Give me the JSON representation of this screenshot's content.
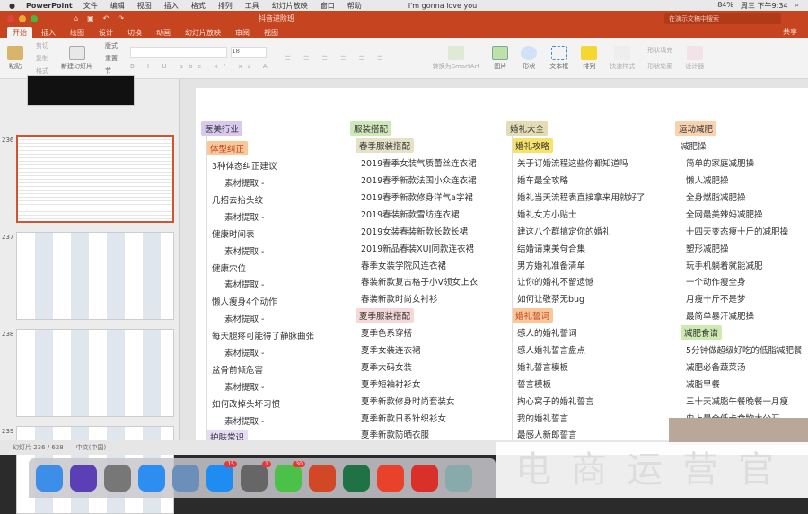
{
  "menubar": {
    "app": "PowerPoint",
    "items": [
      "文件",
      "编辑",
      "视图",
      "插入",
      "格式",
      "排列",
      "工具",
      "幻灯片放映",
      "窗口",
      "帮助"
    ],
    "song": "I'm gonna love you",
    "battery": "84%",
    "clock": "周三 下午9:34"
  },
  "titlebar": {
    "doc_title": "抖音进阶班",
    "search_placeholder": "在演示文稿中搜索",
    "share": "共享"
  },
  "tabs": [
    "开始",
    "插入",
    "绘图",
    "设计",
    "切换",
    "动画",
    "幻灯片放映",
    "审阅",
    "视图"
  ],
  "ribbon": {
    "paste": "粘贴",
    "cut": "剪切",
    "copy": "复制",
    "format": "格式",
    "new_slide": "新建幻灯片",
    "layout": "版式",
    "reset": "重置",
    "section": "节",
    "font_size": "18",
    "smartart": "转换为SmartArt",
    "picture": "图片",
    "shape": "形状",
    "textbox": "文本框",
    "arrange": "排列",
    "quick_styles": "快速样式",
    "shape_fill": "形状填充",
    "shape_outline": "形状轮廓",
    "design_ideas": "设计器"
  },
  "thumbnails": [
    {
      "num": "236",
      "selected": true
    },
    {
      "num": "237"
    },
    {
      "num": "238"
    },
    {
      "num": "239"
    }
  ],
  "mindmap": [
    {
      "root": "医美行业",
      "root_color": "#d9c9ef",
      "nodes": [
        {
          "t": "体型纠正",
          "sub": "#f9c79a"
        },
        {
          "t": "3种体态纠正建议",
          "l": 1
        },
        {
          "t": "素材提取 -",
          "l": 2
        },
        {
          "t": "几招去抬头纹",
          "l": 1
        },
        {
          "t": "素材提取 -",
          "l": 2
        },
        {
          "t": "健康时间表",
          "l": 1
        },
        {
          "t": "素材提取 -",
          "l": 2
        },
        {
          "t": "健康穴位",
          "l": 1
        },
        {
          "t": "素材提取 -",
          "l": 2
        },
        {
          "t": "懒人瘦身4个动作",
          "l": 1
        },
        {
          "t": "素材提取 -",
          "l": 2
        },
        {
          "t": "每天腿疼可能得了静脉曲张",
          "l": 1
        },
        {
          "t": "素材提取 -",
          "l": 2
        },
        {
          "t": "盆骨前倾危害",
          "l": 1
        },
        {
          "t": "素材提取 -",
          "l": 2
        },
        {
          "t": "如何改掉头坏习惯",
          "l": 1
        },
        {
          "t": "素材提取 -",
          "l": 2
        },
        {
          "t": "护肤常识",
          "sub": "#e6dcf5"
        }
      ]
    },
    {
      "root": "服装搭配",
      "root_color": "#cfe8b8",
      "nodes": [
        {
          "t": "春季服装搭配",
          "sub": "#e6e2c8"
        },
        {
          "t": "2019春季女装气质蕾丝连衣裙",
          "l": 1
        },
        {
          "t": "2019春季新款法国小众连衣裙",
          "l": 1
        },
        {
          "t": "2019春季新款修身洋气a字裙",
          "l": 1
        },
        {
          "t": "2019春装新款雪纺连衣裙",
          "l": 1
        },
        {
          "t": "2019女装春装新款长款长裙",
          "l": 1
        },
        {
          "t": "2019新品春装XUJ同款连衣裙",
          "l": 1
        },
        {
          "t": "春季女装学院风连衣裙",
          "l": 1
        },
        {
          "t": "春装新款复古格子小V领女上衣",
          "l": 1
        },
        {
          "t": "春装新款时尚女衬衫",
          "l": 1
        },
        {
          "t": "夏季服装搭配",
          "sub": "#f5d9d9"
        },
        {
          "t": "夏季色系穿搭",
          "l": 1
        },
        {
          "t": "夏季女装连衣裙",
          "l": 1
        },
        {
          "t": "夏季大码女装",
          "l": 1
        },
        {
          "t": "夏季短袖衬衫女",
          "l": 1
        },
        {
          "t": "夏季新款修身时尚套装女",
          "l": 1
        },
        {
          "t": "夏季新款日系针织衫女",
          "l": 1
        },
        {
          "t": "夏季新款防晒衣服",
          "l": 1
        }
      ]
    },
    {
      "root": "婚礼大全",
      "root_color": "#e3dcb5",
      "nodes": [
        {
          "t": "婚礼攻略",
          "sub": "#f7e36a"
        },
        {
          "t": "关于订婚流程这些你都知道吗",
          "l": 1
        },
        {
          "t": "婚车最全攻略",
          "l": 1
        },
        {
          "t": "婚礼当天流程表直接拿来用就好了",
          "l": 1
        },
        {
          "t": "婚礼女方小贴士",
          "l": 1
        },
        {
          "t": "建这八个群搞定你的婚礼",
          "l": 1
        },
        {
          "t": "结婚请柬美句合集",
          "l": 1
        },
        {
          "t": "男方婚礼准备清单",
          "l": 1
        },
        {
          "t": "让你的婚礼不留遗憾",
          "l": 1
        },
        {
          "t": "如何让敬茶无bug",
          "l": 1
        },
        {
          "t": "婚礼誓词",
          "sub": "#f9c79a"
        },
        {
          "t": "感人的婚礼誓词",
          "l": 1
        },
        {
          "t": "感人婚礼誓言盘点",
          "l": 1
        },
        {
          "t": "婚礼誓言模板",
          "l": 1
        },
        {
          "t": "誓言模板",
          "l": 1
        },
        {
          "t": "掏心窝子的婚礼誓言",
          "l": 1
        },
        {
          "t": "我的婚礼誓言",
          "l": 1
        },
        {
          "t": "最感人新郎誓言",
          "l": 1
        }
      ]
    },
    {
      "root": "运动减肥",
      "root_color": "#f9d2b0",
      "nodes": [
        {
          "t": "减肥操",
          "l": 0
        },
        {
          "t": "简单的家庭减肥操",
          "l": 1
        },
        {
          "t": "懒人减肥操",
          "l": 1
        },
        {
          "t": "全身燃脂减肥操",
          "l": 1
        },
        {
          "t": "全网最美辣妈减肥操",
          "l": 1
        },
        {
          "t": "十四天变态瘦十斤的减肥操",
          "l": 1
        },
        {
          "t": "塑形减肥操",
          "l": 1
        },
        {
          "t": "玩手机躺着就能减肥",
          "l": 1
        },
        {
          "t": "一个动作瘦全身",
          "l": 1
        },
        {
          "t": "月瘦十斤不是梦",
          "l": 1
        },
        {
          "t": "最简单暴汗减肥操",
          "l": 1
        },
        {
          "t": "减肥食谱",
          "sub": "#cdeab0"
        },
        {
          "t": "5分钟做超级好吃的低脂减肥餐",
          "l": 1
        },
        {
          "t": "减肥必备蔬菜汤",
          "l": 1
        },
        {
          "t": "减脂早餐",
          "l": 1
        },
        {
          "t": "三十天减脂午餐晚餐一月瘦",
          "l": 1
        },
        {
          "t": "史上最全低卡食物大公开",
          "l": 1
        }
      ]
    }
  ],
  "statusbar": {
    "slide": "幻灯片 236 / 628",
    "lang": "中文(中国)"
  },
  "dock": [
    {
      "name": "finder",
      "color": "#3d8ee8"
    },
    {
      "name": "siri",
      "color": "#5a3fb5"
    },
    {
      "name": "launchpad",
      "color": "#777"
    },
    {
      "name": "safari",
      "color": "#2e8df0"
    },
    {
      "name": "preview",
      "color": "#6b8fb8"
    },
    {
      "name": "app-store",
      "color": "#1e8cf0",
      "badge": "15"
    },
    {
      "name": "system-preferences",
      "color": "#666",
      "badge": "1"
    },
    {
      "name": "wechat",
      "color": "#4cc14a",
      "badge": "30"
    },
    {
      "name": "powerpoint",
      "color": "#d24726"
    },
    {
      "name": "excel",
      "color": "#1f7244"
    },
    {
      "name": "xmind",
      "color": "#e8412c"
    },
    {
      "name": "netease-music",
      "color": "#d9302a"
    },
    {
      "name": "photos",
      "color": "#8aa"
    }
  ],
  "watermark": "电商运营官"
}
